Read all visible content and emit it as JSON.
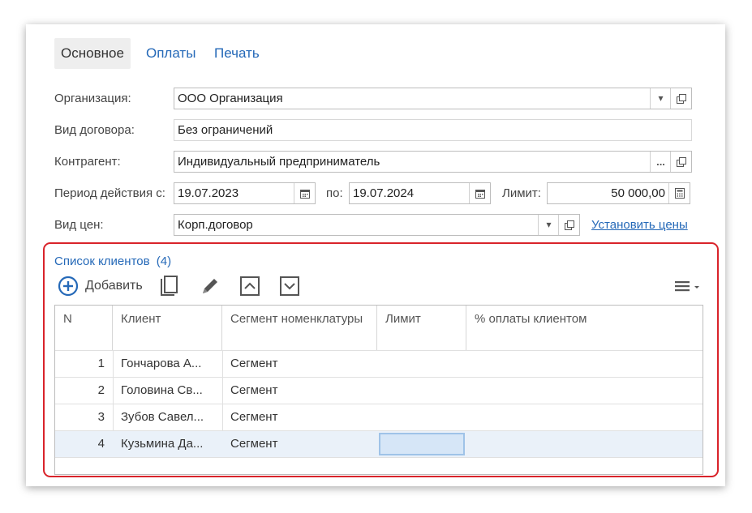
{
  "tabs": [
    {
      "label": "Основное",
      "active": true
    },
    {
      "label": "Оплаты",
      "active": false
    },
    {
      "label": "Печать",
      "active": false
    }
  ],
  "form": {
    "organization": {
      "label": "Организация:",
      "value": "ООО Организация"
    },
    "contract_type": {
      "label": "Вид договора:",
      "value": "Без ограничений"
    },
    "counterparty": {
      "label": "Контрагент:",
      "value": "Индивидуальный предприниматель",
      "select_label": "..."
    },
    "period": {
      "label": "Период действия с:",
      "from": "19.07.2023",
      "to_label": "по:",
      "to": "19.07.2024"
    },
    "limit": {
      "label": "Лимит:",
      "value": "50 000,00"
    },
    "price_type": {
      "label": "Вид цен:",
      "value": "Корп.договор",
      "action": "Установить цены"
    }
  },
  "clients": {
    "title": "Список клиентов",
    "count": "(4)",
    "toolbar": {
      "add_label": "Добавить"
    },
    "columns": [
      "N",
      "Клиент",
      "Сегмент номенклатуры",
      "Лимит",
      "% оплаты клиентом"
    ],
    "rows": [
      {
        "n": "1",
        "client": "Гончарова А...",
        "segment": "Сегмент",
        "limit": "",
        "pay": ""
      },
      {
        "n": "2",
        "client": "Головина Св...",
        "segment": "Сегмент",
        "limit": "",
        "pay": ""
      },
      {
        "n": "3",
        "client": "Зубов Савел...",
        "segment": "Сегмент",
        "limit": "",
        "pay": ""
      },
      {
        "n": "4",
        "client": "Кузьмина Да...",
        "segment": "Сегмент",
        "limit": "",
        "pay": ""
      }
    ],
    "selected_row": 4
  },
  "colors": {
    "link": "#2569b8",
    "highlight_frame": "#d9232a",
    "selected_row": "#eaf1f9"
  }
}
